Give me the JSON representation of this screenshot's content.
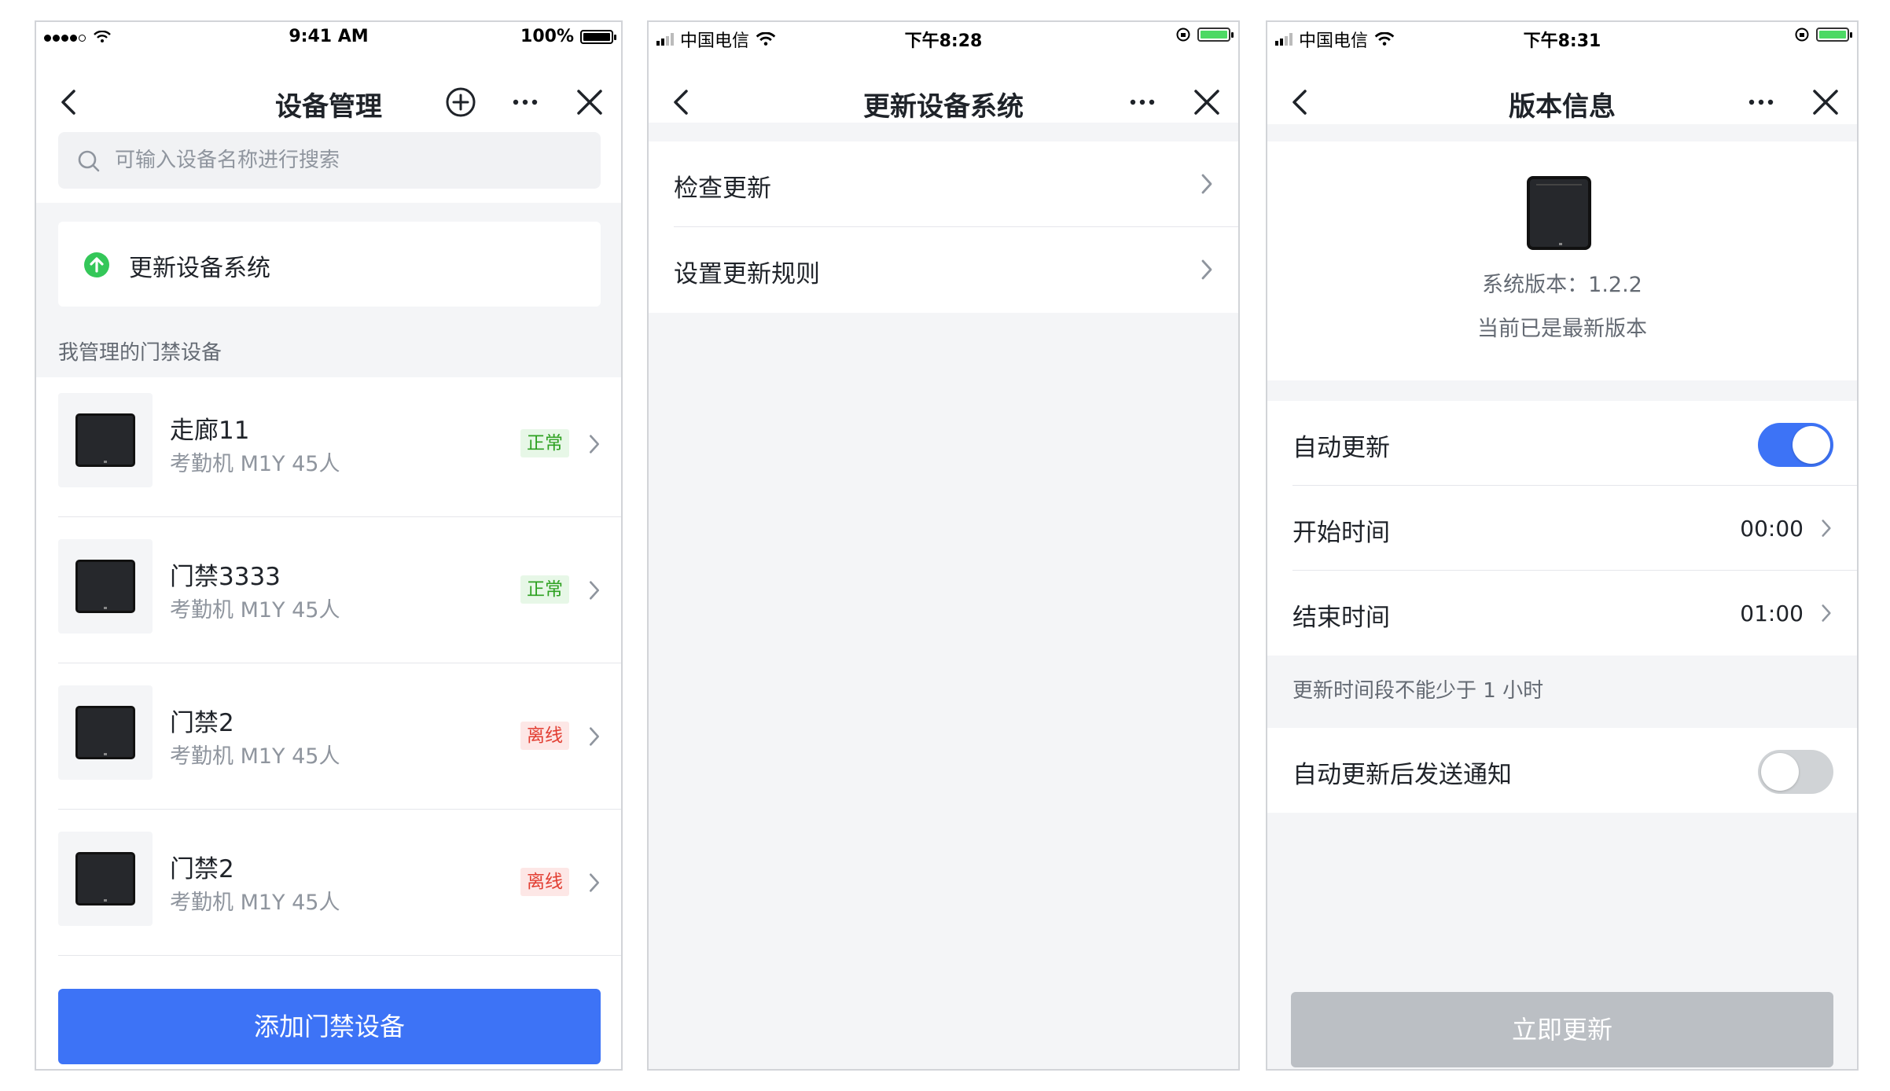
{
  "colors": {
    "accent": "#3d73f6",
    "success": "#2ea121",
    "danger": "#e23e32",
    "disabled": "#bbbfc4"
  },
  "screen1": {
    "status": {
      "time": "9:41 AM",
      "battery": "100%"
    },
    "title": "设备管理",
    "search_placeholder": "可输入设备名称进行搜索",
    "update_entry": "更新设备系统",
    "section_label": "我管理的门禁设备",
    "devices": [
      {
        "name": "走廊11",
        "model": "考勤机 M1Y 45人",
        "status": "正常",
        "status_type": "ok"
      },
      {
        "name": "门禁3333",
        "model": "考勤机 M1Y 45人",
        "status": "正常",
        "status_type": "ok"
      },
      {
        "name": "门禁2",
        "model": "考勤机 M1Y 45人",
        "status": "离线",
        "status_type": "offline"
      },
      {
        "name": "门禁2",
        "model": "考勤机 M1Y 45人",
        "status": "离线",
        "status_type": "offline"
      }
    ],
    "add_button": "添加门禁设备"
  },
  "screen2": {
    "status": {
      "carrier": "中国电信",
      "time": "下午8:28"
    },
    "title": "更新设备系统",
    "items": [
      "检查更新",
      "设置更新规则"
    ]
  },
  "screen3": {
    "status": {
      "carrier": "中国电信",
      "time": "下午8:31"
    },
    "title": "版本信息",
    "version_text": "系统版本：1.2.2",
    "latest_text": "当前已是最新版本",
    "auto_update_label": "自动更新",
    "auto_update_on": true,
    "start_label": "开始时间",
    "start_value": "00:00",
    "end_label": "结束时间",
    "end_value": "01:00",
    "hint": "更新时间段不能少于 1 小时",
    "notify_label": "自动更新后发送通知",
    "notify_on": false,
    "update_button": "立即更新"
  }
}
